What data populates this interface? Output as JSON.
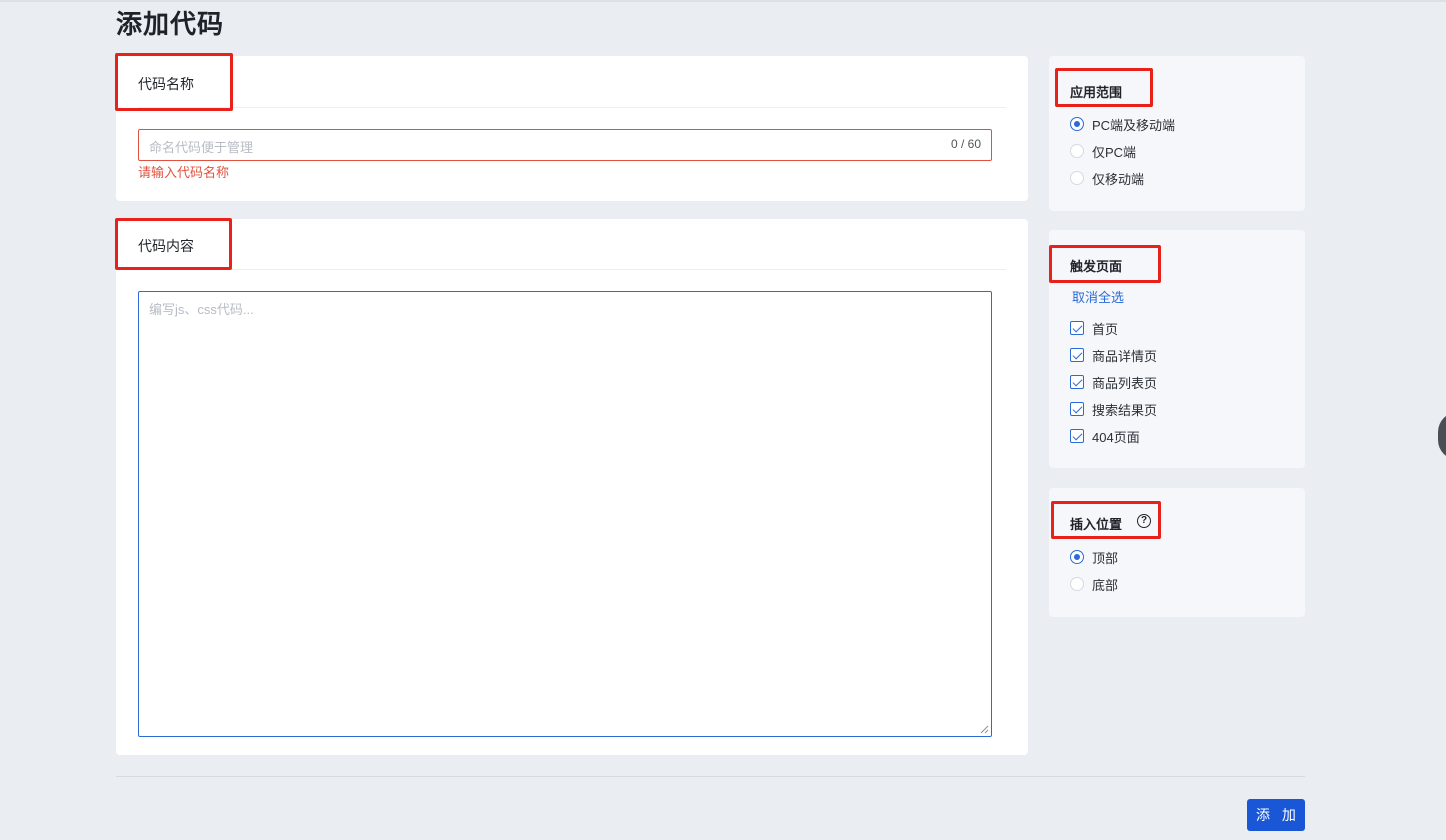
{
  "page": {
    "title": "添加代码"
  },
  "name_card": {
    "title": "代码名称",
    "input_placeholder": "命名代码便于管理",
    "counter": "0 / 60",
    "error": "请输入代码名称"
  },
  "content_card": {
    "title": "代码内容",
    "textarea_placeholder": "编写js、css代码..."
  },
  "scope": {
    "title": "应用范围",
    "options": [
      {
        "label": "PC端及移动端",
        "selected": true
      },
      {
        "label": "仅PC端",
        "selected": false
      },
      {
        "label": "仅移动端",
        "selected": false
      }
    ]
  },
  "trigger": {
    "title": "触发页面",
    "deselect_all": "取消全选",
    "options": [
      {
        "label": "首页",
        "checked": true
      },
      {
        "label": "商品详情页",
        "checked": true
      },
      {
        "label": "商品列表页",
        "checked": true
      },
      {
        "label": "搜索结果页",
        "checked": true
      },
      {
        "label": "404页面",
        "checked": true
      }
    ]
  },
  "position": {
    "title": "插入位置",
    "help_icon": "question-circle-icon",
    "help_glyph": "?",
    "options": [
      {
        "label": "顶部",
        "selected": true
      },
      {
        "label": "底部",
        "selected": false
      }
    ]
  },
  "footer": {
    "add_label": "添 加"
  },
  "colors": {
    "accent": "#2c6bd6",
    "primary_button": "#1a57d6",
    "error": "#e0523f",
    "highlight_box": "#e8211b",
    "background": "#eaedf1"
  }
}
